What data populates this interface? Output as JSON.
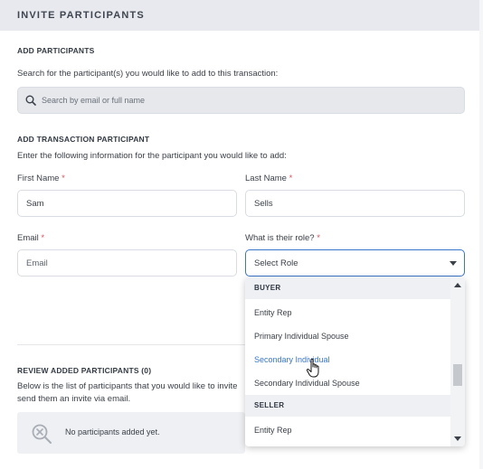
{
  "header": {
    "title": "INVITE PARTICIPANTS"
  },
  "add_participants": {
    "title": "ADD PARTICIPANTS",
    "instructions": "Search for the participant(s) you would like to add to this transaction:",
    "search_placeholder": "Search by email or full name"
  },
  "transaction_participant": {
    "title": "ADD TRANSACTION PARTICIPANT",
    "instructions": "Enter the following information for the participant you would like to add:",
    "first_name_label": "First Name",
    "first_name_value": "Sam",
    "last_name_label": "Last Name",
    "last_name_value": "Sells",
    "email_label": "Email",
    "email_placeholder": "Email",
    "role_label": "What is their role?",
    "role_value": "Select Role",
    "required_mark": "*"
  },
  "review": {
    "title": "REVIEW ADDED PARTICIPANTS (0)",
    "line1": "Below is the list of participants that you would like to invite",
    "line2": "send them an invite via email.",
    "empty_message": "No participants added yet."
  },
  "role_dropdown": {
    "groups": [
      {
        "label": "BUYER",
        "items": [
          "Entity Rep",
          "Primary Individual Spouse",
          "Secondary Individual",
          "Secondary Individual Spouse"
        ]
      },
      {
        "label": "SELLER",
        "items": [
          "Entity Rep"
        ]
      }
    ],
    "hovered_item": "Secondary Individual"
  },
  "colors": {
    "accent": "#3a76c9",
    "required": "#e0505a",
    "header_bg": "#e7e9ee"
  }
}
